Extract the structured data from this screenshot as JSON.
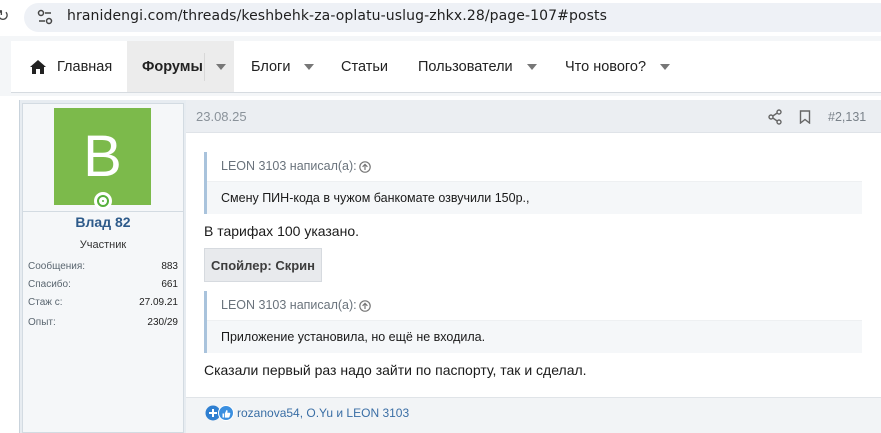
{
  "browser": {
    "url": "hranidengi.com/threads/keshbehk-za-oplatu-uslug-zhkx.28/page-107#posts"
  },
  "nav": {
    "items": [
      {
        "label": "Главная"
      },
      {
        "label": "Форумы"
      },
      {
        "label": "Блоги"
      },
      {
        "label": "Статьи"
      },
      {
        "label": "Пользователи"
      },
      {
        "label": "Что нового?"
      }
    ]
  },
  "user": {
    "avatar_letter": "B",
    "name": "Влад 82",
    "title": "Участник",
    "stats": [
      {
        "label": "Сообщения:",
        "value": "883"
      },
      {
        "label": "Спасибо:",
        "value": "661"
      },
      {
        "label": "Стаж с:",
        "value": "27.09.21"
      },
      {
        "label": "Опыт:",
        "value": "230/29"
      }
    ],
    "avatar_color": "#7cba4b"
  },
  "post": {
    "date": "23.08.25",
    "number": "#2,131",
    "quote1": {
      "author": "LEON 3103 написал(а):",
      "text": "Смену ПИН-кода в чужом банкомате озвучили 150р.,"
    },
    "line1": "В тарифах 100 указано.",
    "spoiler_label": "Спойлер: Скрин",
    "quote2": {
      "author": "LEON 3103 написал(а):",
      "text": "Приложение установила, но ещё не входила."
    },
    "line2": "Сказали первый раз надо зайти по паспорту, так и сделал.",
    "reactions": "rozanova54, O.Yu и LEON 3103"
  }
}
